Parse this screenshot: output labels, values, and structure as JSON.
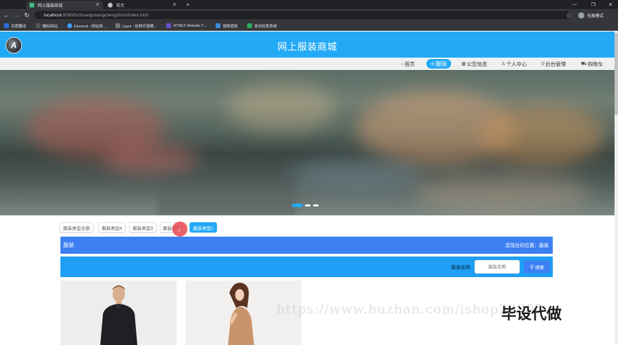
{
  "browser": {
    "tabs": [
      {
        "title": "网上服装商城",
        "active": true
      },
      {
        "title": "首页",
        "active": false
      }
    ],
    "new_tab": "+",
    "url_host": "localhost",
    "url_path": ":8080/fuzhuangshangcheng/front/index.html",
    "profile_label": "无痕模式",
    "bookmarks": [
      {
        "label": "百度翻译",
        "color": "#2b6de1"
      },
      {
        "label": "酷标网站",
        "color": "#333333"
      },
      {
        "label": "Element - 网站快...",
        "color": "#409eff"
      },
      {
        "label": "Layui - 经典开源模...",
        "color": "#2c2c2c"
      },
      {
        "label": "HTML5 Website T...",
        "color": "#6b4fcf"
      },
      {
        "label": "搜索壁纸",
        "color": "#3a8de0"
      },
      {
        "label": "原创检索系统",
        "color": "#2fae5b"
      }
    ]
  },
  "site": {
    "title": "网上服装商城",
    "logo_letter": "A",
    "brand_color": "#22aaf6"
  },
  "nav": [
    {
      "label": "首页",
      "icon": "home-icon",
      "glyph": "⌂",
      "active": false
    },
    {
      "label": "服装",
      "icon": "shirt-icon",
      "glyph": "◎",
      "active": true
    },
    {
      "label": "公告信息",
      "icon": "notice-icon",
      "glyph": "▦",
      "active": false
    },
    {
      "label": "个人中心",
      "icon": "user-icon",
      "glyph": "♙",
      "active": false
    },
    {
      "label": "后台管理",
      "icon": "link-icon",
      "glyph": "⚲",
      "active": false
    },
    {
      "label": "购物车",
      "icon": "cart-icon",
      "glyph": "⛟",
      "active": false
    }
  ],
  "categories": [
    {
      "label": "服装类型全部",
      "active": false
    },
    {
      "label": "服装类型4",
      "active": false
    },
    {
      "label": "服装类型3",
      "active": false
    },
    {
      "label": "服装类型2",
      "active": false
    },
    {
      "label": "服装类型1",
      "active": true
    }
  ],
  "section": {
    "title": "服装",
    "breadcrumb": "您现在的位置：服装"
  },
  "search": {
    "label": "服装名称",
    "placeholder": "服装名称",
    "button": "搜索"
  },
  "watermark": {
    "url": "https://www.huzhan.com/ishop29897",
    "text": "毕设代做"
  }
}
